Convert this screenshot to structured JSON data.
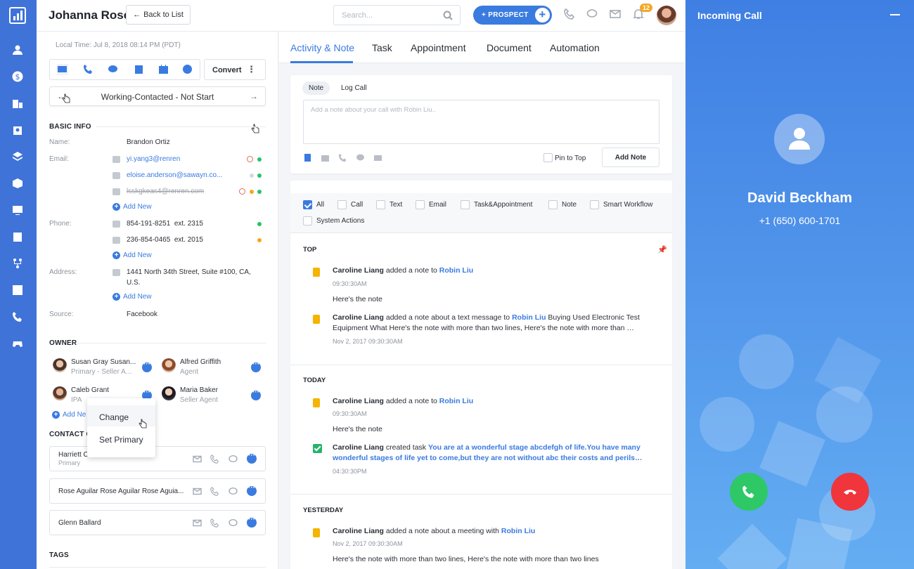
{
  "header": {
    "contact_name": "Johanna Rose",
    "back_label": "Back to List",
    "search_placeholder": "Search...",
    "prospect_label": "+ PROSPECT",
    "notification_count": "12"
  },
  "left": {
    "local_time": "Local Time: Jul 8, 2018 08:14 PM (PDT)",
    "convert_label": "Convert",
    "stage": "Working-Contacted - Not Start",
    "basic_info_title": "BASIC INFO",
    "name_label": "Name:",
    "name_value": "Brandon Ortiz",
    "email_label": "Email:",
    "emails": [
      "yi.yang3@renren",
      "eloise.anderson@sawayn.co...",
      "lsskgkeas4@renren.com"
    ],
    "phone_label": "Phone:",
    "phones": [
      "854-191-8251  ext. 2315",
      "236-854-0465  ext. 2015"
    ],
    "address_label": "Address:",
    "address_line1": "1441 North 34th Street, Suite #100, CA,",
    "address_line2": "U.S.",
    "source_label": "Source:",
    "source_value": "Facebook",
    "add_new": "Add New",
    "owner_title": "OWNER",
    "owners": [
      {
        "name": "Susan Gray Susan...",
        "role": "Primary - Seller A..."
      },
      {
        "name": "Alfred Griffith",
        "role": "Agent"
      },
      {
        "name": "Caleb Grant",
        "role": "IPA"
      },
      {
        "name": "Maria Baker",
        "role": "Seller Agent"
      }
    ],
    "add_new_truncated": "Add Ne",
    "menu": {
      "change": "Change",
      "set_primary": "Set Primary"
    },
    "contact_group_title": "CONTACT G",
    "contact_groups": [
      {
        "name": "Harriett C",
        "role": "Primary"
      },
      {
        "name": "Rose Aguilar Rose Aguilar Rose Aguia..."
      },
      {
        "name": "Glenn Ballard"
      }
    ],
    "tags_title": "TAGS"
  },
  "tabs": [
    "Activity & Note",
    "Task",
    "Appointment",
    "Document",
    "Automation"
  ],
  "note": {
    "tab_note": "Note",
    "tab_log_call": "Log Call",
    "placeholder": "Add a note about your call with Robin Liu..",
    "pin_label": "Pin to Top",
    "add_button": "Add Note"
  },
  "filters": [
    "All",
    "Call",
    "Text",
    "Email",
    "Task&Appointment",
    "Note",
    "Smart Workflow",
    "System Actions"
  ],
  "feed": {
    "groups": [
      "TOP",
      "TODAY",
      "YESTERDAY"
    ],
    "items": [
      {
        "actor": "Caroline Liang",
        "action": " added a note to ",
        "target": "Robin Liu",
        "rest": "",
        "time": "09:30:30AM",
        "body": "Here's the note"
      },
      {
        "actor": "Caroline Liang",
        "action": " added a note about a text message to ",
        "target": "Robin Liu",
        "rest": " Buying Used Electronic Test Equipment What Here's the note with more than two lines, Here's the note with more than …",
        "time": "Nov 2, 2017 09:30:30AM",
        "body": ""
      },
      {
        "actor": "Caroline Liang",
        "action": " added a note to ",
        "target": "Robin Liu",
        "rest": "",
        "time": "09:30:30AM",
        "body": "Here's the note"
      },
      {
        "actor": "Caroline Liang",
        "action": " created task ",
        "target": "You are at a wonderful stage abcdefgh of life.You have many wonderful stages of life yet to come,but they are not without abc their costs and perils…",
        "rest": "",
        "time": "04:30:30PM",
        "body": ""
      },
      {
        "actor": "Caroline Liang",
        "action": " added a note about a meeting with ",
        "target": "Robin Liu",
        "rest": "",
        "time": "Nov 2, 2017 09:30:30AM",
        "body": "Here's the note with more than two lines, Here's the note with more than two lines"
      }
    ]
  },
  "call": {
    "title": "Incoming Call",
    "caller_name": "David Beckham",
    "caller_number": "+1 (650) 600-1701"
  },
  "colors": {
    "primary": "#3a7be0",
    "sidebar": "#3f73d8",
    "accept": "#2ec866",
    "reject": "#f0353d",
    "note_icon": "#f5b400"
  }
}
